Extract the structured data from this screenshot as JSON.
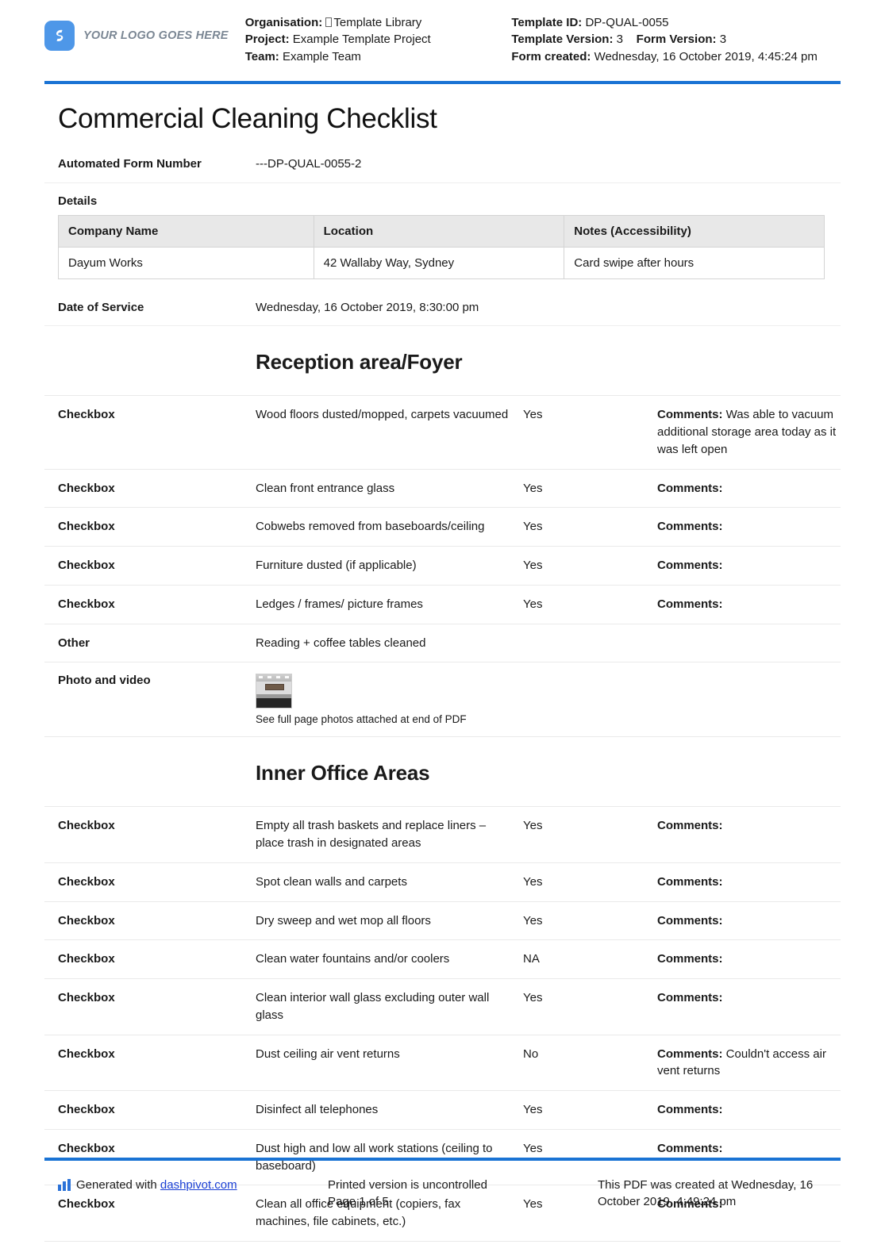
{
  "header": {
    "logo_text": "YOUR LOGO GOES HERE",
    "org_label": "Organisation:",
    "org_value": "Template Library",
    "project_label": "Project:",
    "project_value": "Example Template Project",
    "team_label": "Team:",
    "team_value": "Example Team",
    "template_id_label": "Template ID:",
    "template_id_value": "DP-QUAL-0055",
    "template_version_label": "Template Version:",
    "template_version_value": "3",
    "form_version_label": "Form Version:",
    "form_version_value": "3",
    "form_created_label": "Form created:",
    "form_created_value": "Wednesday, 16 October 2019, 4:45:24 pm"
  },
  "title": "Commercial Cleaning Checklist",
  "form_number": {
    "label": "Automated Form Number",
    "value": "---DP-QUAL-0055-2"
  },
  "details": {
    "section_label": "Details",
    "columns": [
      "Company Name",
      "Location",
      "Notes (Accessibility)"
    ],
    "rows": [
      [
        "Dayum Works",
        "42 Wallaby Way, Sydney",
        "Card swipe after hours"
      ]
    ]
  },
  "date_of_service": {
    "label": "Date of Service",
    "value": "Wednesday, 16 October 2019, 8:30:00 pm"
  },
  "sections": [
    {
      "heading": "Reception area/Foyer",
      "rows": [
        {
          "type": "Checkbox",
          "task": "Wood floors dusted/mopped, carpets vacuumed",
          "status": "Yes",
          "comments_label": "Comments:",
          "comments_value": " Was able to vacuum additional storage area today as it was left open"
        },
        {
          "type": "Checkbox",
          "task": "Clean front entrance glass",
          "status": "Yes",
          "comments_label": "Comments:",
          "comments_value": ""
        },
        {
          "type": "Checkbox",
          "task": "Cobwebs removed from baseboards/ceiling",
          "status": "Yes",
          "comments_label": "Comments:",
          "comments_value": ""
        },
        {
          "type": "Checkbox",
          "task": "Furniture dusted (if applicable)",
          "status": "Yes",
          "comments_label": "Comments:",
          "comments_value": ""
        },
        {
          "type": "Checkbox",
          "task": "Ledges / frames/ picture frames",
          "status": "Yes",
          "comments_label": "Comments:",
          "comments_value": ""
        },
        {
          "type": "Other",
          "task": "Reading + coffee tables cleaned",
          "status": "",
          "comments_label": "",
          "comments_value": ""
        }
      ],
      "photo_row": {
        "type": "Photo and video",
        "caption": "See full page photos attached at end of PDF"
      }
    },
    {
      "heading": "Inner Office Areas",
      "rows": [
        {
          "type": "Checkbox",
          "task": "Empty all trash baskets and replace liners – place trash in designated areas",
          "status": "Yes",
          "comments_label": "Comments:",
          "comments_value": ""
        },
        {
          "type": "Checkbox",
          "task": "Spot clean walls and carpets",
          "status": "Yes",
          "comments_label": "Comments:",
          "comments_value": ""
        },
        {
          "type": "Checkbox",
          "task": "Dry sweep and wet mop all floors",
          "status": "Yes",
          "comments_label": "Comments:",
          "comments_value": ""
        },
        {
          "type": "Checkbox",
          "task": "Clean water fountains and/or coolers",
          "status": "NA",
          "comments_label": "Comments:",
          "comments_value": ""
        },
        {
          "type": "Checkbox",
          "task": "Clean interior wall glass excluding outer wall glass",
          "status": "Yes",
          "comments_label": "Comments:",
          "comments_value": ""
        },
        {
          "type": "Checkbox",
          "task": "Dust ceiling air vent returns",
          "status": "No",
          "comments_label": "Comments:",
          "comments_value": " Couldn't access air vent returns"
        },
        {
          "type": "Checkbox",
          "task": "Disinfect all telephones",
          "status": "Yes",
          "comments_label": "Comments:",
          "comments_value": ""
        },
        {
          "type": "Checkbox",
          "task": "Dust high and low all work stations (ceiling to baseboard)",
          "status": "Yes",
          "comments_label": "Comments:",
          "comments_value": ""
        },
        {
          "type": "Checkbox",
          "task": "Clean all office equipment (copiers, fax machines, file cabinets, etc.)",
          "status": "Yes",
          "comments_label": "Comments:",
          "comments_value": ""
        }
      ]
    }
  ],
  "footer": {
    "generated_prefix": "Generated with ",
    "generated_link": "dashpivot.com",
    "uncontrolled_text": "Printed version is uncontrolled",
    "page_text": "Page 1 of 5",
    "created_text": "This PDF was created at Wednesday, 16 October 2019, 4:49:24 pm"
  },
  "colors": {
    "accent_blue": "#1a73d4",
    "logo_blue": "#4e97e8",
    "link_blue": "#1a3fd4",
    "table_header_gray": "#e8e8e8"
  }
}
